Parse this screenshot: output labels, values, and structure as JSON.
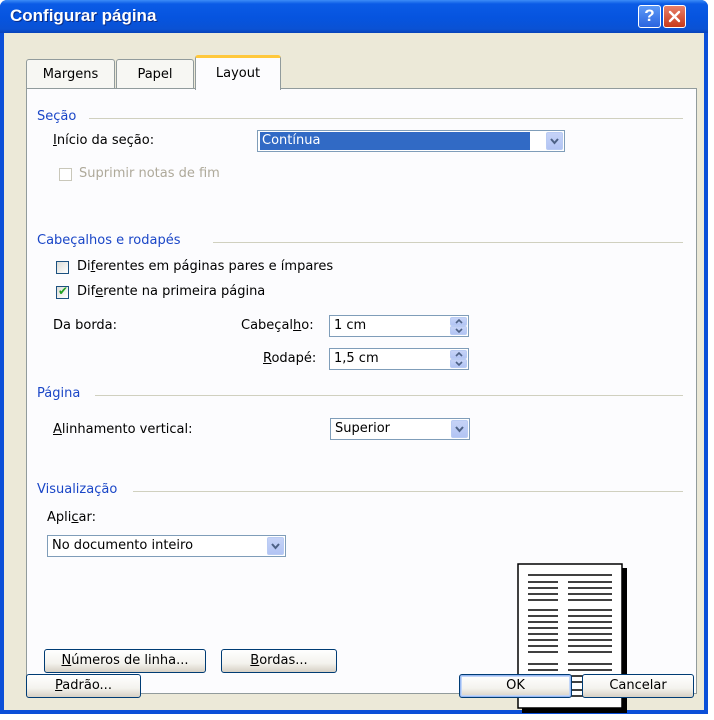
{
  "window": {
    "title": "Configurar página",
    "help_label": "?",
    "close_label": "✕"
  },
  "tabs": [
    {
      "label": "Margens",
      "active": false
    },
    {
      "label": "Papel",
      "active": false
    },
    {
      "label": "Layout",
      "active": true
    }
  ],
  "secao": {
    "heading": "Seção",
    "inicio_label": "Início da seção:",
    "inicio_value": "Contínua",
    "suprimir_label": "Suprimir notas de fim",
    "suprimir_checked": false,
    "suprimir_enabled": false
  },
  "cabecalhos": {
    "heading": "Cabeçalhos e rodapés",
    "pares_label": "Diferentes em páginas pares e ímpares",
    "pares_checked": false,
    "primeira_label": "Diferente na primeira página",
    "primeira_checked": true,
    "borda_label": "Da borda:",
    "cabecalho_label": "Cabeçalho:",
    "cabecalho_value": "1 cm",
    "rodape_label": "Rodapé:",
    "rodape_value": "1,5 cm"
  },
  "pagina": {
    "heading": "Página",
    "alinhamento_label": "Alinhamento vertical:",
    "alinhamento_value": "Superior"
  },
  "visualizacao": {
    "heading": "Visualização",
    "aplicar_label": "Aplicar:",
    "aplicar_value": "No documento inteiro"
  },
  "buttons": {
    "numeros_linha": "Números de linha...",
    "bordas": "Bordas...",
    "padrao": "Padrão...",
    "ok": "OK",
    "cancelar": "Cancelar"
  },
  "colors": {
    "titlebar": "#0654DF",
    "dialog_bg": "#ECE9D8",
    "group_heading": "#1A46C7",
    "selection": "#316AC5",
    "active_tab_accent": "#FFC83C"
  }
}
